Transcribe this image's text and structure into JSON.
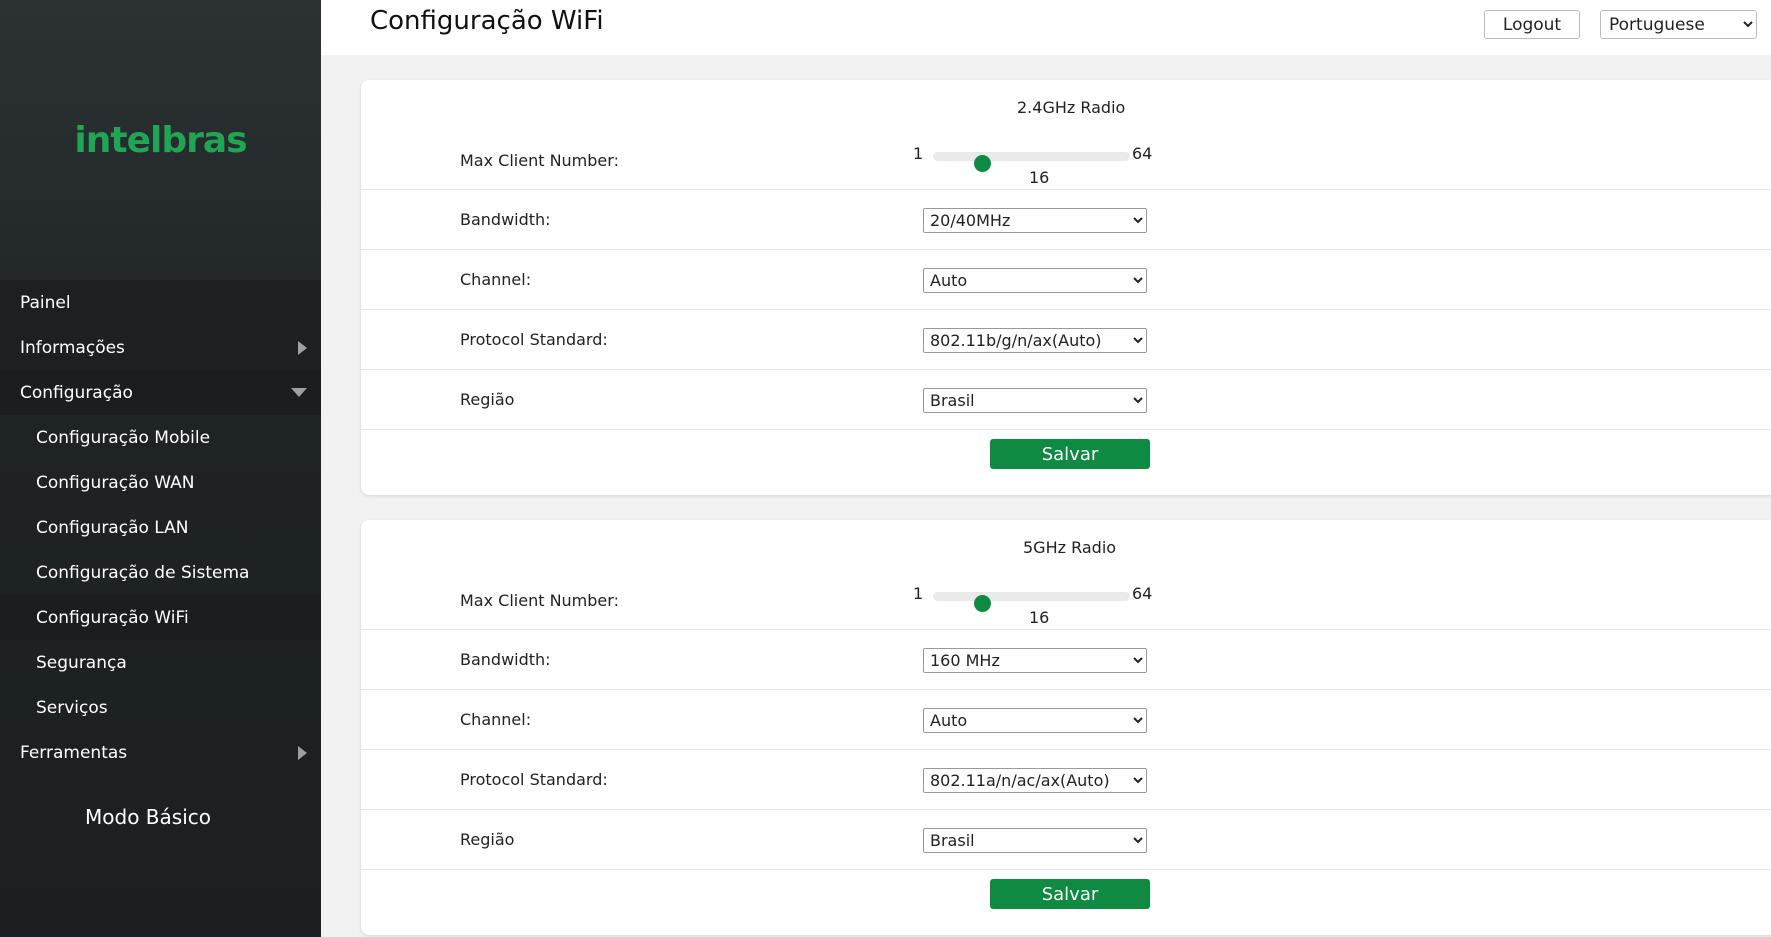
{
  "brand": {
    "logo_text": "intelbras",
    "accent_color": "#0e8a42"
  },
  "header": {
    "title": "Configuração WiFi",
    "logout_label": "Logout",
    "language": "Portuguese"
  },
  "sidebar": {
    "items": [
      {
        "label": "Painel"
      },
      {
        "label": "Informações"
      },
      {
        "label": "Configuração"
      },
      {
        "label": "Configuração Mobile"
      },
      {
        "label": "Configuração WAN"
      },
      {
        "label": "Configuração LAN"
      },
      {
        "label": "Configuração de Sistema"
      },
      {
        "label": "Configuração WiFi"
      },
      {
        "label": "Segurança"
      },
      {
        "label": "Serviços"
      },
      {
        "label": "Ferramentas"
      }
    ],
    "basic_mode_label": "Modo Básico"
  },
  "radio24": {
    "title": "2.4GHz Radio",
    "max_client_label": "Max Client Number:",
    "slider_min": "1",
    "slider_max": "64",
    "slider_value": "16",
    "bandwidth_label": "Bandwidth:",
    "bandwidth_value": "20/40MHz",
    "channel_label": "Channel:",
    "channel_value": "Auto",
    "protocol_label": "Protocol Standard:",
    "protocol_value": "802.11b/g/n/ax(Auto)",
    "region_label": "Região",
    "region_value": "Brasil",
    "save_label": "Salvar"
  },
  "radio5": {
    "title": "5GHz Radio",
    "max_client_label": "Max Client Number:",
    "slider_min": "1",
    "slider_max": "64",
    "slider_value": "16",
    "bandwidth_label": "Bandwidth:",
    "bandwidth_value": "160 MHz",
    "channel_label": "Channel:",
    "channel_value": "Auto",
    "protocol_label": "Protocol Standard:",
    "protocol_value": "802.11a/n/ac/ax(Auto)",
    "region_label": "Região",
    "region_value": "Brasil",
    "save_label": "Salvar"
  }
}
